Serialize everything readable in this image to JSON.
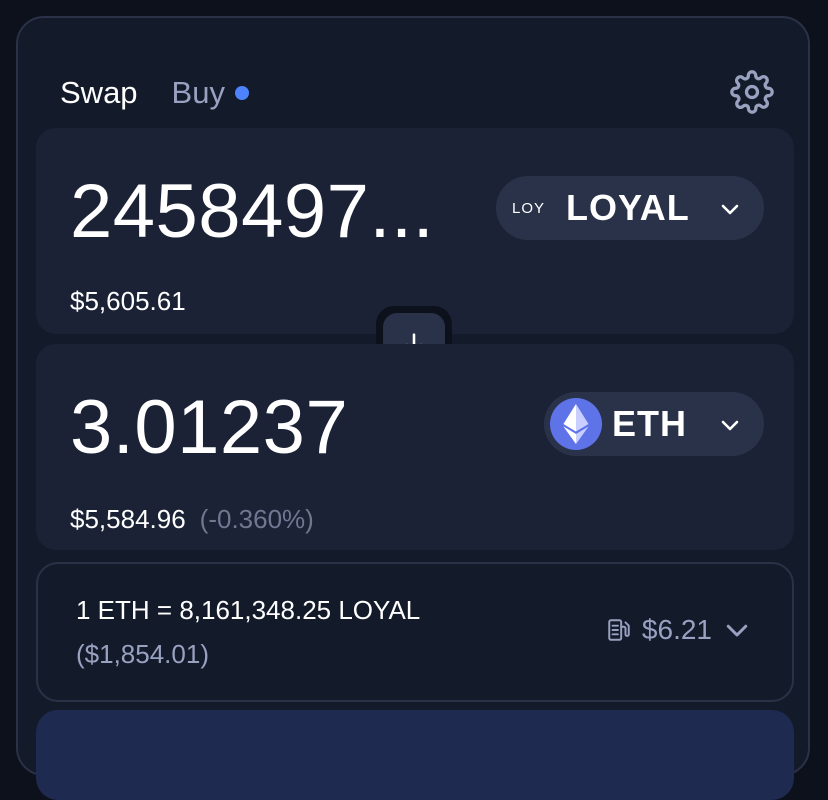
{
  "tabs": {
    "swap": "Swap",
    "buy": "Buy"
  },
  "sell": {
    "amount": "2458497...",
    "usd": "$5,605.61",
    "token_badge": "LOY",
    "token_symbol": "LOYAL"
  },
  "buy": {
    "amount": "3.01237",
    "usd": "$5,584.96",
    "price_impact": "(-0.360%)",
    "token_symbol": "ETH"
  },
  "rate": {
    "line": "1 ETH = 8,161,348.25 LOYAL",
    "usd": "($1,854.01)",
    "gas": "$6.21"
  },
  "colors": {
    "background": "#0d111c",
    "panel": "#1b2236",
    "accent_dot": "#4c82fb",
    "eth_logo": "#5f73e9",
    "muted_text": "#98a1c0"
  },
  "icons": {
    "settings": "gear-icon",
    "swap_direction": "arrow-down-icon",
    "token_select": "chevron-down-icon",
    "gas": "gas-pump-icon",
    "eth": "ethereum-icon"
  }
}
